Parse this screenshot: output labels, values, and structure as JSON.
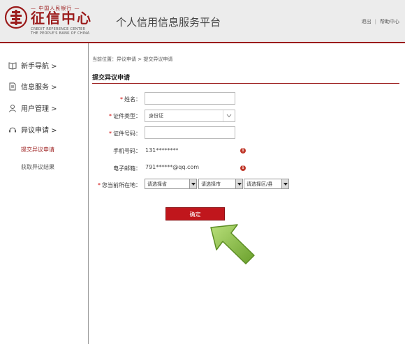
{
  "header": {
    "logo_top": "— 中国人民银行 —",
    "logo_main": "征信中心",
    "logo_en_line1": "CREDIT REFERENCE CENTER",
    "logo_en_line2": "THE PEOPLE'S BANK OF CHINA",
    "platform_title": "个人信用信息服务平台",
    "logout_label": "退出",
    "separator": "|",
    "help_label": "帮助中心"
  },
  "sidebar": {
    "items": [
      {
        "label": "新手导航 >",
        "icon": "book-icon"
      },
      {
        "label": "信息服务 >",
        "icon": "document-icon"
      },
      {
        "label": "用户管理 >",
        "icon": "user-icon"
      },
      {
        "label": "异议申请 >",
        "icon": "headset-icon"
      }
    ],
    "sub_items": [
      {
        "label": "提交异议申请",
        "active": true
      },
      {
        "label": "获取异议结果",
        "active": false
      }
    ]
  },
  "main": {
    "breadcrumb": "当前位置：异议申请 > 提交异议申请",
    "section_title": "提交异议申请",
    "form": {
      "name_label": "姓名：",
      "name_value": "",
      "id_type_label": "证件类型：",
      "id_type_value": "身份证",
      "id_number_label": "证件号码：",
      "id_number_value": "",
      "phone_label": "手机号码：",
      "phone_value": "131********",
      "email_label": "电子邮箱：",
      "email_value": "791******@qq.com",
      "location_label": "您当前所在地：",
      "province_placeholder": "请选择省",
      "city_placeholder": "请选择市",
      "district_placeholder": "请选择区/县",
      "required_mark": "*",
      "submit_label": "确定"
    }
  },
  "colors": {
    "brand_red": "#9b1b1b",
    "button_red": "#c0161c",
    "arrow_green": "#7fb53a"
  }
}
